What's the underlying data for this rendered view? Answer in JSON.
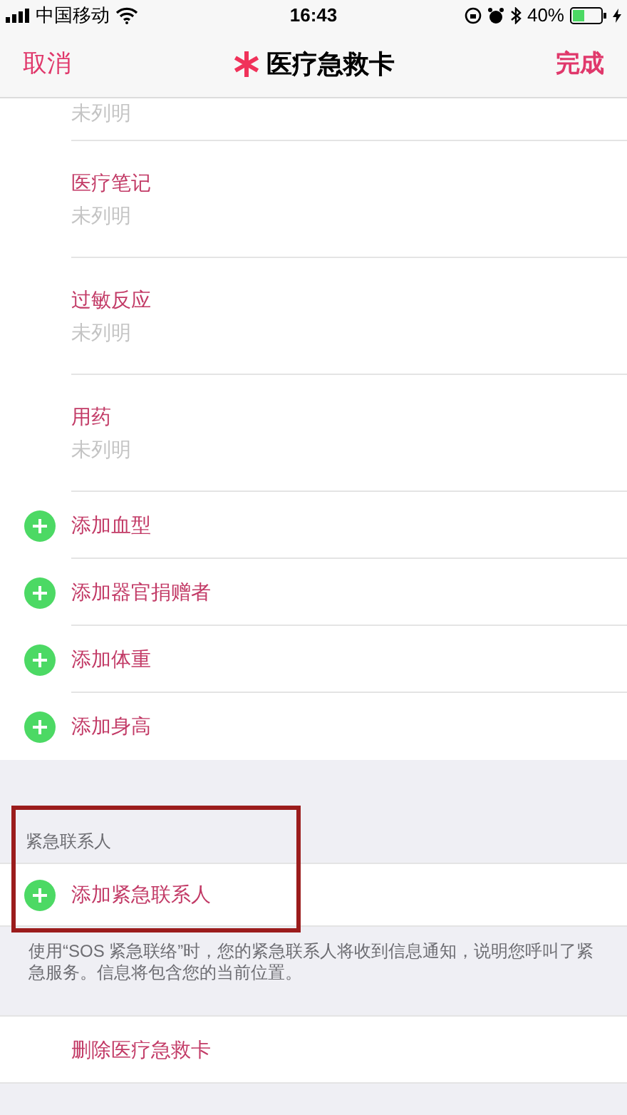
{
  "status_bar": {
    "carrier": "中国移动",
    "time": "16:43",
    "battery": "40%"
  },
  "nav": {
    "cancel": "取消",
    "title": "医疗急救卡",
    "done": "完成"
  },
  "fields": [
    {
      "value": "未列明"
    },
    {
      "label": "医疗笔记",
      "value": "未列明"
    },
    {
      "label": "过敏反应",
      "value": "未列明"
    },
    {
      "label": "用药",
      "value": "未列明"
    }
  ],
  "add_items": [
    "添加血型",
    "添加器官捐赠者",
    "添加体重",
    "添加身高"
  ],
  "emergency": {
    "header": "紧急联系人",
    "add": "添加紧急联系人",
    "highlighted": true,
    "note": "使用“SOS 紧急联络”时，您的紧急联系人将收到信息通知，说明您呼叫了紧急服务。信息将包含您的当前位置。"
  },
  "delete": "删除医疗急救卡"
}
